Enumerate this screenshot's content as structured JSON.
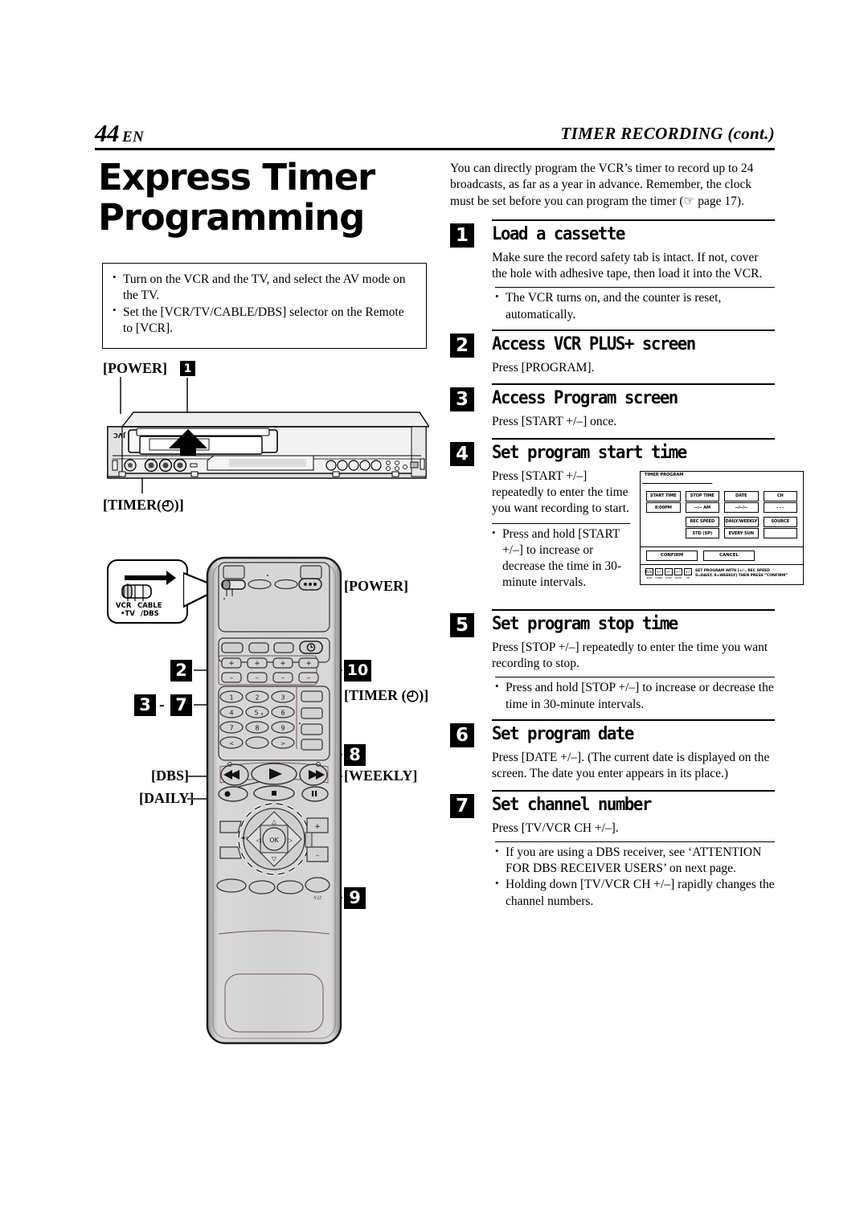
{
  "header": {
    "page_number": "44",
    "locale": "EN",
    "running_head": "TIMER RECORDING (cont.)"
  },
  "left": {
    "title_line1": "Express Timer",
    "title_line2": "Programming",
    "notes": [
      "Turn on the VCR and the TV, and select the AV mode on the TV.",
      "Set the [VCR/TV/CABLE/DBS] selector on the Remote to [VCR]."
    ],
    "vcr_callouts": {
      "power_label": "[POWER]",
      "step1_badge": "1",
      "timer_label": "[TIMER(◴)]"
    },
    "selector_bubble": {
      "vcr": "VCR",
      "tv": "TV",
      "cable": "CABLE",
      "dbs": "/DBS",
      "tv_dot": "•"
    },
    "remote_callouts": {
      "power_label": "[POWER]",
      "badge_2": "2",
      "badge_10": "10",
      "timer_label": "[TIMER (◴)]",
      "badge_3": "3",
      "range_dash": "-",
      "badge_7": "7",
      "badge_8": "8",
      "weekly_label": "[WEEKLY]",
      "dbs_label": "[DBS]",
      "daily_label": "[DAILY]",
      "badge_9": "9"
    },
    "remote_keys": {
      "numbers": [
        "1",
        "2",
        "3",
        "4",
        "5",
        "6",
        "7",
        "8",
        "9"
      ],
      "five_sub": "o",
      "plus": "+",
      "minus": "−",
      "ok": "OK",
      "up": "△",
      "down": "▽",
      "left": "◁",
      "right": "▷",
      "play": "▶",
      "rew": "◀◀",
      "ff": "▶▶",
      "rec": "●",
      "stop": "■",
      "pause": "❙❙",
      "timer_glyph": "◴"
    },
    "vcr_brand": "JVC"
  },
  "right": {
    "intro": "You can directly program the VCR’s timer to record up to 24 broadcasts, as far as a year in advance. Remember, the clock must be set before you can program the timer (☞ page 17).",
    "steps": [
      {
        "num": "1",
        "title": "Load a cassette",
        "body": "Make sure the record safety tab is intact. If not, cover the hole with adhesive tape, then load it into the VCR.",
        "bullets": [
          "The VCR turns on, and the counter is reset, automatically."
        ]
      },
      {
        "num": "2",
        "title": "Access VCR PLUS+ screen",
        "body": "Press [PROGRAM].",
        "bullets": []
      },
      {
        "num": "3",
        "title": "Access Program screen",
        "body": "Press [START +/–] once.",
        "bullets": []
      },
      {
        "num": "4",
        "title": "Set program start time",
        "body": "Press [START +/–] repeatedly to enter the time you want recording to start.",
        "bullets": [
          "Press and hold [START +/–] to increase or decrease the time in 30-minute intervals."
        ]
      },
      {
        "num": "5",
        "title": "Set program stop time",
        "body": "Press [STOP +/–] repeatedly to enter the time you want recording to stop.",
        "bullets": [
          "Press and hold [STOP +/–] to increase or decrease the time in 30-minute intervals."
        ]
      },
      {
        "num": "6",
        "title": "Set program date",
        "body": "Press [DATE +/–]. (The current date is displayed on the screen. The date you enter appears in its place.)",
        "bullets": []
      },
      {
        "num": "7",
        "title": "Set channel number",
        "body": "Press [TV/VCR CH +/–].",
        "bullets": [
          "If you are using a DBS receiver, see ‘ATTENTION FOR DBS RECEIVER USERS’ on next page.",
          "Holding down [TV/VCR CH +/–] rapidly changes the channel numbers."
        ]
      }
    ],
    "osd": {
      "tab_label": "TIMER PROGRAM",
      "fields": [
        {
          "caption": "START TIME",
          "value": "8:00PM",
          "highlight": true
        },
        {
          "caption": "STOP TIME",
          "value": "--:-- AM",
          "highlight": false
        },
        {
          "caption": "DATE",
          "value": "--/--/--",
          "highlight": false
        },
        {
          "caption": "CH",
          "value": "- - -",
          "highlight": false
        }
      ],
      "fields_row2": [
        {
          "caption": "REC SPEED",
          "value": "STD (SP)"
        },
        {
          "caption": "DAILY/WEEKLY",
          "value": "EVERY SUN"
        },
        {
          "caption": "SOURCE",
          "value": ""
        }
      ],
      "buttons": [
        "CONFIRM",
        "CANCEL"
      ],
      "key_legend": [
        {
          "key": "PROG.",
          "label": "EXIT"
        },
        {
          "key": "+/-",
          "label": "START"
        },
        {
          "key": "+/-",
          "label": "STOP"
        },
        {
          "key": "+/-",
          "label": "DATE"
        },
        {
          "key": "+/-",
          "label": "CH"
        }
      ],
      "help_line1": "SET PROGRAM WITH [+/–, REC SPEED",
      "help_line2": "8=DAILY, 9=WEEKLY] THEN PRESS “CONFIRM”"
    }
  },
  "colors": {
    "ink": "#000000",
    "leader": "#4a4a4a",
    "device_fill": "#e6e6e6",
    "device_shade": "#cfcfcf"
  }
}
